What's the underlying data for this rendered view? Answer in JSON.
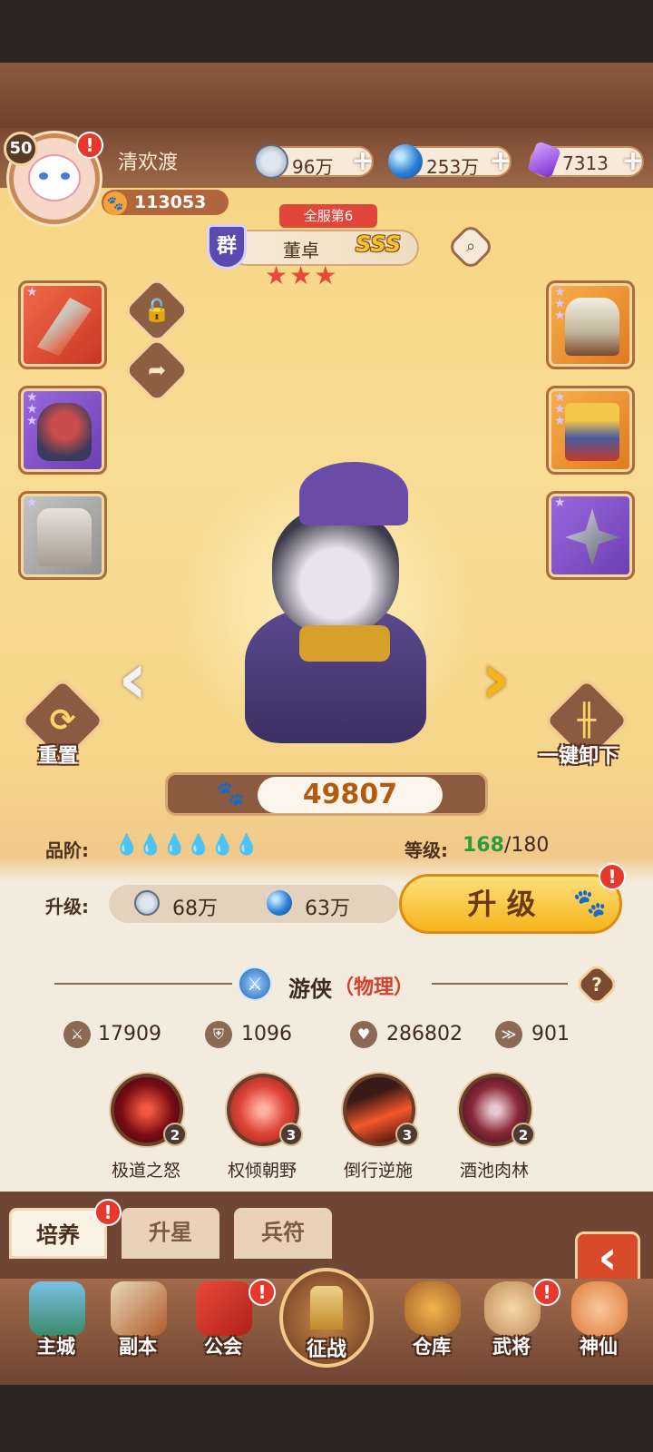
{
  "player": {
    "level": "50",
    "name": "清欢渡",
    "power": "113053"
  },
  "resources": [
    {
      "name": "copper",
      "value": "96万",
      "icon": "coin-icon"
    },
    {
      "name": "jade",
      "value": "253万",
      "icon": "blue-orb-icon"
    },
    {
      "name": "gem",
      "value": "7313",
      "icon": "purple-gem-icon"
    }
  ],
  "hero": {
    "rank_badge": "全服第6",
    "faction": "群",
    "name": "董卓",
    "grade": "SSS",
    "stars": 3,
    "combat_power": "49807",
    "quality_label": "品阶:",
    "level_label": "等级:",
    "level_current": "168",
    "level_max": "/180",
    "upgrade_label": "升级:",
    "upgrade_cost_copper": "68万",
    "upgrade_cost_jade": "63万",
    "upgrade_button": "升 级",
    "class": "游侠",
    "damage_type": "（物理）",
    "stats": {
      "attack": "17909",
      "defense": "1096",
      "hp": "286802",
      "speed": "901"
    }
  },
  "actions": {
    "reset": "重置",
    "unequip_all": "一键卸下"
  },
  "skills": [
    {
      "name": "极道之怒",
      "level": "2",
      "color": "#b2202a"
    },
    {
      "name": "权倾朝野",
      "level": "3",
      "color": "#d8413a"
    },
    {
      "name": "倒行逆施",
      "level": "3",
      "color": "#7a2a1e"
    },
    {
      "name": "酒池肉林",
      "level": "2",
      "color": "#6e2a3a"
    }
  ],
  "tabs": [
    "培养",
    "升星",
    "兵符"
  ],
  "nav": [
    "主城",
    "副本",
    "公会",
    "征战",
    "仓库",
    "武将",
    "神仙"
  ],
  "colors": {
    "level_green": "#2e9a3a",
    "power_orange": "#b25a10",
    "upgrade_yellow": "#f5c02c"
  }
}
